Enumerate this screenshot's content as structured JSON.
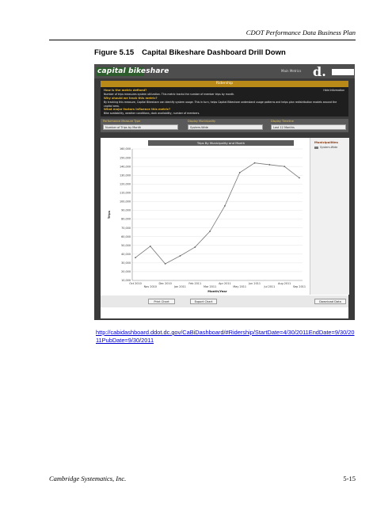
{
  "page": {
    "header": "CDOT Performance Data Business Plan",
    "figure_number": "Figure 5.15",
    "figure_title": "Capital Bikeshare Dashboard Drill Down",
    "url": "http://cabidashboard.ddot.dc.gov/CaBiDashboard/#Ridership/StartDate=4/30/2011EndDate=9/30/2011PubDate=9/30/2011",
    "footer_left": "Cambridge Systematics, Inc.",
    "footer_right": "5-15"
  },
  "dashboard": {
    "logo": "capital bikeshare",
    "main_metrics": "Main Metrics",
    "brand_mark": "d.",
    "panel_title": "Ridership",
    "hide_info": "Hide Information",
    "info": [
      {
        "q": "How is the metric defined?",
        "a": "Number of trips measures system utilization. This metric tracks the number of member trips by month."
      },
      {
        "q": "Why should we track this metric?",
        "a": "By tracking this measure, Capital Bikeshare can identify system usage. This in turn, helps Capital Bikeshare understand usage patterns and helps plan redistribution models around the capital area."
      },
      {
        "q": "What major factors influence this metric?",
        "a": "Bike availability, weather conditions, dock availability, number of members."
      }
    ],
    "filters": [
      {
        "label": "Performance Measure Type",
        "value": "Number of Trips by Month"
      },
      {
        "label": "Display Municipality",
        "value": "System-Wide"
      },
      {
        "label": "Display Timeline",
        "value": "Last 12 Months"
      }
    ],
    "legend_title": "Municipalities",
    "legend_item": "System-Wide",
    "print_chart": "Print Chart",
    "export_chart": "Export Chart",
    "download_data": "Download Data"
  },
  "chart_data": {
    "type": "line",
    "title": "Trips By Municipality and Month",
    "xlabel": "Month/Year",
    "ylabel": "Trips",
    "categories": [
      "Oct 2010",
      "Nov 2010",
      "Dec 2010",
      "Jan 2011",
      "Feb 2011",
      "Mar 2011",
      "Apr 2011",
      "May 2011",
      "Jun 2011",
      "Jul 2011",
      "Aug 2011",
      "Sep 2011"
    ],
    "series": [
      {
        "name": "System-Wide",
        "values": [
          36000,
          49000,
          29000,
          38000,
          48000,
          66000,
          95000,
          133000,
          144000,
          142000,
          140000,
          127000
        ]
      }
    ],
    "yticks": [
      "10,000",
      "20,000",
      "30,000",
      "40,000",
      "50,000",
      "60,000",
      "70,000",
      "80,000",
      "90,000",
      "100,000",
      "110,000",
      "120,000",
      "130,000",
      "140,000",
      "150,000",
      "160,000"
    ],
    "ylim": [
      10000,
      160000
    ],
    "color": "#777777",
    "grid": true,
    "legend": "right"
  }
}
